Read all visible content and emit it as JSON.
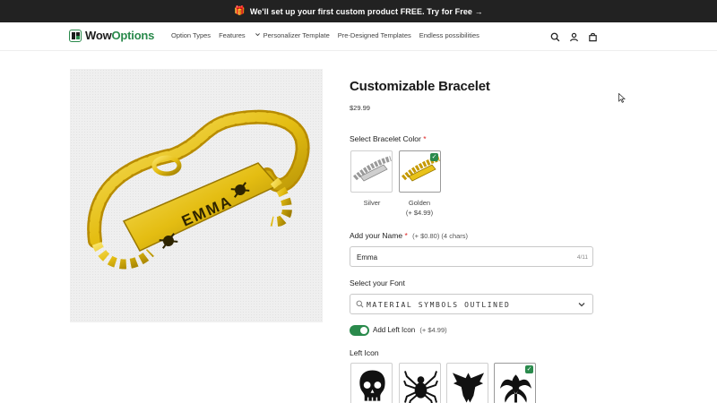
{
  "announcement": {
    "gift_icon": "gift-icon",
    "text": "We'll set up your first custom product FREE. Try for Free →"
  },
  "header": {
    "logo": {
      "part1": "Wow",
      "part2": "Options",
      "accent_color": "#2a8a4c"
    },
    "nav": [
      {
        "label": "Option Types"
      },
      {
        "label": "Features"
      },
      {
        "label": "Personalizer Template"
      },
      {
        "label": "Pre-Designed Templates"
      },
      {
        "label": "Endless possibilities"
      }
    ],
    "icons": [
      "search-icon",
      "user-icon",
      "cart-icon"
    ]
  },
  "product": {
    "image_text": "EMMA",
    "title": "Customizable Bracelet",
    "price": "$29.99"
  },
  "color_option": {
    "label": "Select Bracelet Color",
    "required": "*",
    "choices": [
      {
        "name": "Silver",
        "extra": ""
      },
      {
        "name": "Golden",
        "extra": "(+ $4.99)",
        "selected": true
      }
    ]
  },
  "name_option": {
    "label": "Add your Name",
    "required": "*",
    "extra": "(+ $0.80) (4 chars)",
    "value": "Emma",
    "counter": "4/11"
  },
  "font_option": {
    "label": "Select your Font",
    "value": "MATERIAL SYMBOLS OUTLINED"
  },
  "left_icon_toggle": {
    "label": "Add Left Icon",
    "extra": "(+ $4.99)",
    "enabled": true
  },
  "left_icon": {
    "label": "Left Icon",
    "choices": [
      "skull-icon",
      "spider-icon",
      "eagle-icon",
      "tribal-spider-icon"
    ],
    "selected": "tribal-spider-icon"
  },
  "colors": {
    "accent": "#2a8a4c",
    "required": "#d22222",
    "gold": "#e8c21a"
  }
}
